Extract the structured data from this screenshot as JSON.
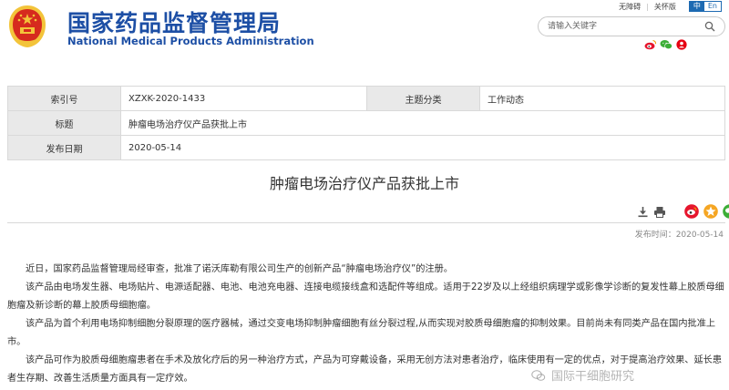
{
  "header": {
    "site_name_cn": "国家药品监督管理局",
    "site_name_en": "National Medical Products Administration",
    "accessibility_link": "无障碍",
    "care_version_link": "关怀版",
    "lang_cn": "中",
    "lang_en": "En",
    "search_placeholder": "请输入关键字",
    "social_icons": [
      "weibo-icon",
      "wechat-icon",
      "user-icon"
    ]
  },
  "meta": {
    "index_label": "索引号",
    "index_value": "XZXK-2020-1433",
    "category_label": "主题分类",
    "category_value": "工作动态",
    "title_label": "标题",
    "title_value": "肿瘤电场治疗仪产品获批上市",
    "date_label": "发布日期",
    "date_value": "2020-05-14"
  },
  "article": {
    "title": "肿瘤电场治疗仪产品获批上市",
    "publish_time": "发布时间：2020-05-14",
    "paragraphs": [
      "近日，国家药品监督管理局经审查，批准了诺沃库勒有限公司生产的创新产品“肿瘤电场治疗仪”的注册。",
      "该产品由电场发生器、电场贴片、电源适配器、电池、电池充电器、连接电缆接线盒和选配件等组成。适用于22岁及以上经组织病理学或影像学诊断的复发性幕上胶质母细胞瘤及新诊断的幕上胶质母细胞瘤。",
      "该产品为首个利用电场抑制细胞分裂原理的医疗器械，通过交变电场抑制肿瘤细胞有丝分裂过程,从而实现对胶质母细胞瘤的抑制效果。目前尚未有同类产品在国内批准上市。",
      "该产品可作为胶质母细胞瘤患者在手术及放化疗后的另一种治疗方式，产品为可穿戴设备，采用无创方法对患者治疗，临床使用有一定的优点，对于提高治疗效果、延长患者生存期、改善生活质量方面具有一定疗效。"
    ]
  },
  "tools": [
    "download-icon",
    "print-icon",
    "weibo-share-icon",
    "qzone-share-icon",
    "wechat-share-icon"
  ],
  "watermark": "国际干细胞研究",
  "colors": {
    "brand_blue": "#1d4fa5",
    "label_bg": "#e9e9e9",
    "emblem_red": "#d62a1e",
    "emblem_gold": "#f3c43a"
  }
}
